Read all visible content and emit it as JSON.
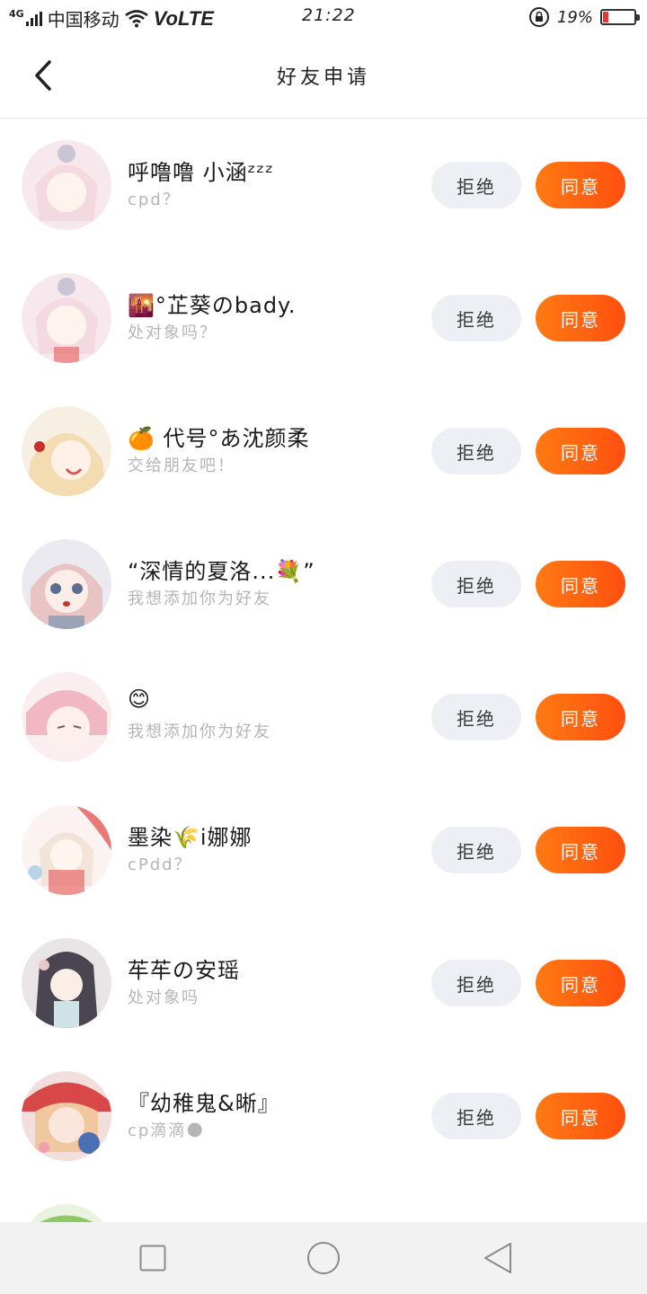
{
  "status_bar": {
    "network": "4G",
    "carrier": "中国移动",
    "volte": "VoLTE",
    "time": "21:22",
    "battery_percent": "19%",
    "battery_level": 0.19,
    "battery_color": "#e53935"
  },
  "header": {
    "back_icon": "chevron-left-icon",
    "title": "好友申请"
  },
  "colors": {
    "accent_from": "#ff7a12",
    "accent_to": "#ff4f10",
    "reject_bg": "#eeeff4",
    "secondary_text": "#b5b5b5"
  },
  "requests": [
    {
      "name": "呼噜噜  小涵ᶻᶻᶻ",
      "message": "cpd？",
      "reject_label": "拒绝",
      "accept_label": "同意"
    },
    {
      "name": "🌇°芷葵のbady.",
      "message": "处对象吗？",
      "reject_label": "拒绝",
      "accept_label": "同意"
    },
    {
      "name": "🍊    代号°あ沈颜柔",
      "message": "交给朋友吧！",
      "reject_label": "拒绝",
      "accept_label": "同意"
    },
    {
      "name": "“深情的夏洛...💐”",
      "message": "我想添加你为好友",
      "reject_label": "拒绝",
      "accept_label": "同意"
    },
    {
      "name": "😊",
      "message": "我想添加你为好友",
      "reject_label": "拒绝",
      "accept_label": "同意"
    },
    {
      "name": "墨染🌾i娜娜",
      "message": "cPdd？",
      "reject_label": "拒绝",
      "accept_label": "同意"
    },
    {
      "name": "䒜䒜の安瑶",
      "message": "处对象吗",
      "reject_label": "拒绝",
      "accept_label": "同意"
    },
    {
      "name": "『幼稚鬼&晰』",
      "message": "cp滴滴🌑",
      "reject_label": "拒绝",
      "accept_label": "同意"
    }
  ],
  "nav": {
    "recents_icon": "square-icon",
    "home_icon": "circle-icon",
    "back_icon": "triangle-back-icon"
  }
}
